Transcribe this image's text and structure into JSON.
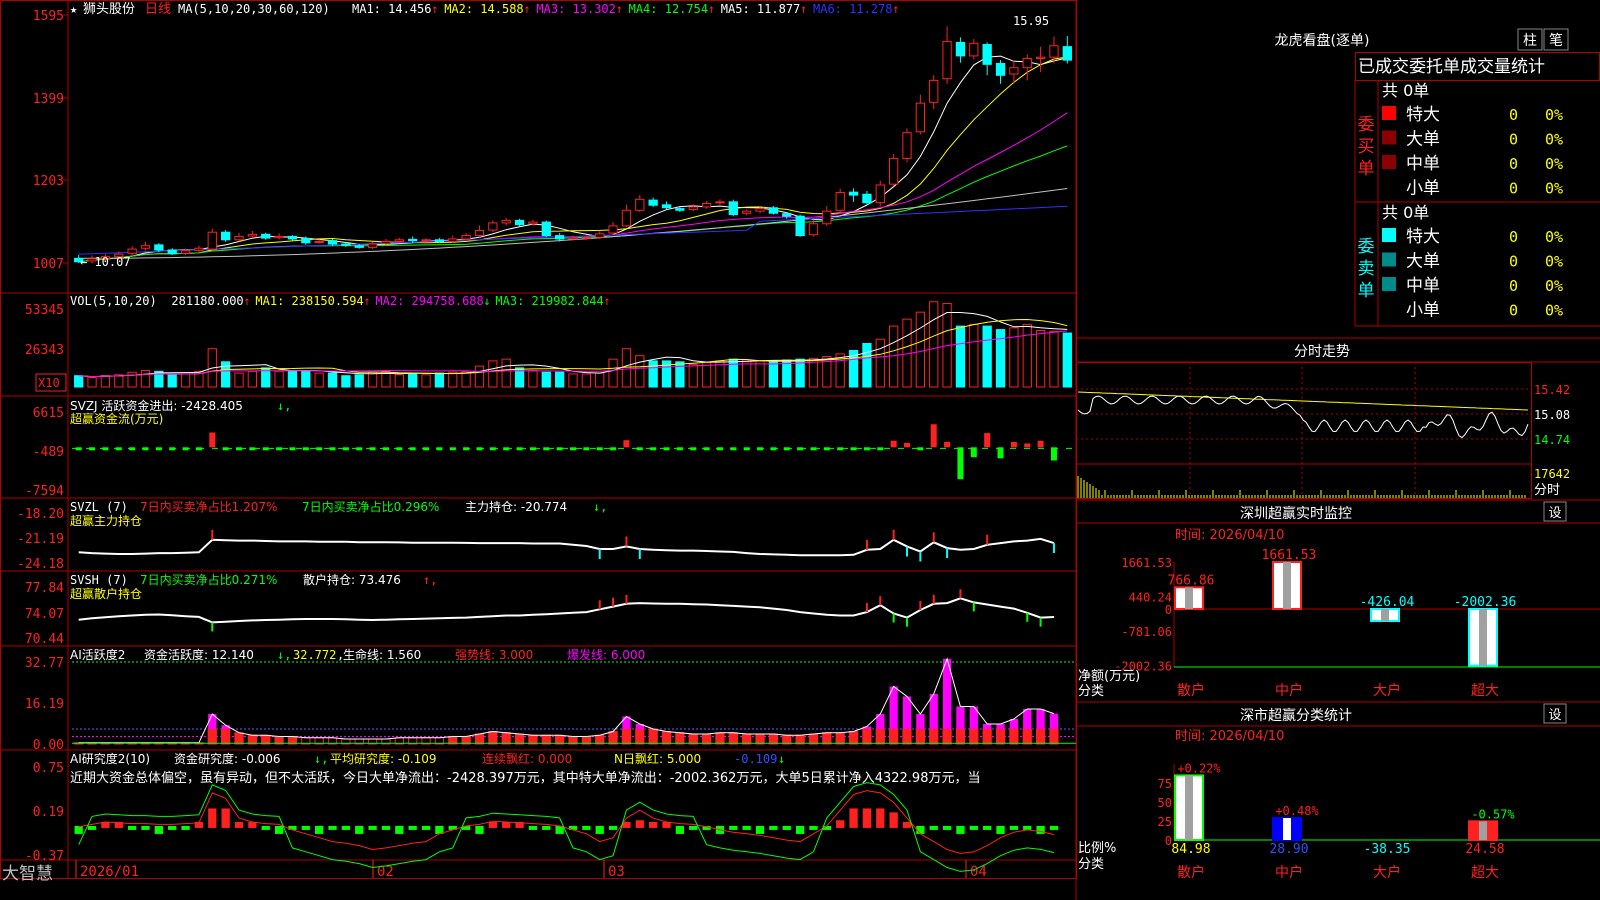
{
  "colors": {
    "up": "#ff2020",
    "down": "#00ffff",
    "grid": "#b00000",
    "ma1": "#ffffff",
    "ma2": "#ffff00",
    "ma3": "#ff00ff",
    "ma4": "#00ff00",
    "ma5": "#c0c0c0",
    "ma6": "#3030ff",
    "bg": "#000000"
  },
  "stock": {
    "star": "★",
    "name": "狮头股份",
    "period": "日线",
    "ma_params": "MA(5,10,20,30,60,120)",
    "mas": [
      {
        "label": "MA1: 14.456",
        "color": "#ffffff"
      },
      {
        "label": "MA2: 14.588",
        "color": "#ffff00"
      },
      {
        "label": "MA3: 13.302",
        "color": "#ff00ff"
      },
      {
        "label": "MA4: 12.754",
        "color": "#00ff00"
      },
      {
        "label": "MA5: 11.877",
        "color": "#ffffff"
      },
      {
        "label": "MA6: 11.278",
        "color": "#3030ff"
      }
    ],
    "high_label": "15.95",
    "low_label": "← 10.07"
  },
  "axis": {
    "price_ticks": [
      "1595",
      "1399",
      "1203",
      "1007"
    ],
    "vol_ticks": [
      "53345",
      "26343"
    ],
    "vol_unit": "X10",
    "svzj_ticks": [
      "6615",
      "-489",
      "-7594"
    ],
    "svzl_ticks": [
      "-18.20",
      "-21.19",
      "-24.18"
    ],
    "svsh_ticks": [
      "77.84",
      "74.07",
      "70.44"
    ],
    "ai_ticks": [
      "32.77",
      "16.19",
      "0.00"
    ],
    "res_ticks": [
      "0.75",
      "0.19",
      "-0.37"
    ],
    "dates": [
      "2026/01",
      "02",
      "03",
      "04"
    ]
  },
  "vol_header": {
    "params": "VOL(5,10,20)",
    "value": "281180.000",
    "ma1": "MA1: 238150.594",
    "ma2": "MA2: 294758.688",
    "ma3": "MA3: 219982.844"
  },
  "svzj_header": {
    "line1": "SVZJ  活跃资金进出: -2428.405",
    "line2": "超赢资金流(万元)"
  },
  "svzl_header": {
    "params": "SVZL (7)",
    "t1": "7日内买卖净占比1.207%",
    "t2": "7日内买卖净占比0.296%",
    "t3": "主力持仓: -20.774",
    "line2": "超赢主力持仓"
  },
  "svsh_header": {
    "params": "SVSH (7)",
    "t1": "7日内买卖净占比0.271%",
    "t2": "散户持仓: 73.476",
    "line2": "超赢散户持仓"
  },
  "ai_header": {
    "params": "AI活跃度2",
    "t1": "资金活跃度: 12.140",
    "t2": "32.772",
    "t3": "生命线: 1.560",
    "t4": "强势线: 3.000",
    "t5": "爆发线: 6.000"
  },
  "res_header": {
    "params": "AI研究度2(10)",
    "t1": "资金研究度: -0.006",
    "t2": "平均研究度: -0.109",
    "t3": "连续飘红: 0.000",
    "t4": "N日飘红: 5.000",
    "t5": "-0.109"
  },
  "res_comment": "近期大资金总体偏空，虽有异动，但不太活跃，今日大单净流出：-2428.397万元，其中特大单净流出：-2002.362万元，大单5日累计净入4322.98万元，当",
  "footer": {
    "brand": "大智慧"
  },
  "longhu": {
    "title": "龙虎看盘(逐单)",
    "btn1": "柱",
    "btn2": "笔",
    "tabs": "已成交委托单成交量统计",
    "buy": {
      "side": "委买单",
      "total": "共 0单",
      "rows": [
        {
          "label": "特大",
          "count": "0",
          "pct": "0%"
        },
        {
          "label": "大单",
          "count": "0",
          "pct": "0%"
        },
        {
          "label": "中单",
          "count": "0",
          "pct": "0%"
        },
        {
          "label": "小单",
          "count": "0",
          "pct": "0%"
        }
      ]
    },
    "sell": {
      "side": "委卖单",
      "total": "共 0单",
      "rows": [
        {
          "label": "特大",
          "count": "0",
          "pct": "0%"
        },
        {
          "label": "大单",
          "count": "0",
          "pct": "0%"
        },
        {
          "label": "中单",
          "count": "0",
          "pct": "0%"
        },
        {
          "label": "小单",
          "count": "0",
          "pct": "0%"
        }
      ]
    }
  },
  "intraday": {
    "title": "分时走势",
    "ticks": [
      "15.42",
      "15.08",
      "14.74",
      "17642"
    ],
    "unit": "分时"
  },
  "monitor": {
    "title": "深圳超赢实时监控",
    "btn": "设",
    "time": "时间: 2026/04/10",
    "ticks": [
      "1661.53",
      "440.24",
      "0",
      "-781.06",
      "-2002.36"
    ],
    "ylabel": "净额(万元)",
    "xlabel": "分类",
    "bars": [
      {
        "cat": "散户",
        "value": 766.86,
        "label": "766.86"
      },
      {
        "cat": "中户",
        "value": 1661.53,
        "label": "1661.53"
      },
      {
        "cat": "大户",
        "value": -426.04,
        "label": "-426.04"
      },
      {
        "cat": "超大",
        "value": -2002.36,
        "label": "-2002.36"
      }
    ]
  },
  "classify": {
    "title": "深市超赢分类统计",
    "btn": "设",
    "time": "时间: 2026/04/10",
    "ticks": [
      "75",
      "50",
      "25",
      "0"
    ],
    "ylabel": "比例%",
    "xlabel": "分类",
    "bars": [
      {
        "cat": "散户",
        "value": 84.98,
        "label": "84.98",
        "top": "+0.22%"
      },
      {
        "cat": "中户",
        "value": 28.9,
        "label": "28.90",
        "top": "+0.48%"
      },
      {
        "cat": "大户",
        "value": -38.35,
        "label": "-38.35",
        "top": ""
      },
      {
        "cat": "超大",
        "value": 24.58,
        "label": "24.58",
        "top": "-0.57%"
      }
    ]
  },
  "chart_data": {
    "type": "candlestick",
    "candles": [
      [
        10.18,
        10.1,
        10.26,
        10.07
      ],
      [
        10.12,
        10.17,
        10.25,
        10.06
      ],
      [
        10.18,
        10.22,
        10.28,
        10.14
      ],
      [
        10.22,
        10.28,
        10.34,
        10.18
      ],
      [
        10.3,
        10.4,
        10.47,
        10.24
      ],
      [
        10.42,
        10.48,
        10.57,
        10.36
      ],
      [
        10.5,
        10.38,
        10.54,
        10.33
      ],
      [
        10.38,
        10.29,
        10.42,
        10.26
      ],
      [
        10.3,
        10.36,
        10.41,
        10.26
      ],
      [
        10.37,
        10.42,
        10.48,
        10.31
      ],
      [
        10.4,
        10.8,
        10.88,
        10.36
      ],
      [
        10.8,
        10.62,
        10.85,
        10.57
      ],
      [
        10.62,
        10.7,
        10.78,
        10.58
      ],
      [
        10.71,
        10.75,
        10.83,
        10.66
      ],
      [
        10.75,
        10.66,
        10.79,
        10.62
      ],
      [
        10.67,
        10.7,
        10.77,
        10.63
      ],
      [
        10.7,
        10.64,
        10.73,
        10.6
      ],
      [
        10.65,
        10.55,
        10.7,
        10.5
      ],
      [
        10.57,
        10.58,
        10.63,
        10.53
      ],
      [
        10.6,
        10.52,
        10.64,
        10.48
      ],
      [
        10.52,
        10.49,
        10.56,
        10.45
      ],
      [
        10.48,
        10.44,
        10.52,
        10.41
      ],
      [
        10.44,
        10.52,
        10.57,
        10.4
      ],
      [
        10.53,
        10.58,
        10.64,
        10.49
      ],
      [
        10.58,
        10.62,
        10.67,
        10.54
      ],
      [
        10.63,
        10.6,
        10.7,
        10.55
      ],
      [
        10.6,
        10.62,
        10.66,
        10.56
      ],
      [
        10.62,
        10.58,
        10.66,
        10.54
      ],
      [
        10.58,
        10.64,
        10.72,
        10.55
      ],
      [
        10.64,
        10.72,
        10.78,
        10.6
      ],
      [
        10.72,
        10.84,
        10.96,
        10.68
      ],
      [
        10.85,
        11.02,
        11.08,
        10.8
      ],
      [
        11.02,
        11.08,
        11.14,
        10.96
      ],
      [
        11.08,
        10.98,
        11.12,
        10.94
      ],
      [
        11.0,
        11.04,
        11.09,
        10.96
      ],
      [
        11.04,
        10.72,
        11.08,
        10.68
      ],
      [
        10.72,
        10.64,
        10.78,
        10.58
      ],
      [
        10.64,
        10.67,
        10.72,
        10.6
      ],
      [
        10.67,
        10.68,
        10.72,
        10.62
      ],
      [
        10.68,
        10.76,
        10.82,
        10.64
      ],
      [
        10.78,
        10.95,
        11.04,
        10.74
      ],
      [
        10.95,
        11.32,
        11.45,
        10.92
      ],
      [
        11.32,
        11.58,
        11.68,
        11.28
      ],
      [
        11.56,
        11.44,
        11.62,
        11.4
      ],
      [
        11.45,
        11.38,
        11.53,
        11.34
      ],
      [
        11.36,
        11.32,
        11.4,
        11.28
      ],
      [
        11.34,
        11.4,
        11.46,
        11.3
      ],
      [
        11.4,
        11.48,
        11.54,
        11.36
      ],
      [
        11.5,
        11.52,
        11.58,
        11.45
      ],
      [
        11.52,
        11.22,
        11.57,
        11.18
      ],
      [
        11.25,
        11.3,
        11.34,
        11.2
      ],
      [
        11.3,
        11.36,
        11.4,
        11.25
      ],
      [
        11.38,
        11.25,
        11.42,
        11.22
      ],
      [
        11.24,
        11.18,
        11.28,
        11.12
      ],
      [
        11.18,
        10.72,
        11.22,
        10.69
      ],
      [
        10.74,
        11.0,
        11.1,
        10.7
      ],
      [
        11.0,
        11.3,
        11.42,
        10.95
      ],
      [
        11.32,
        11.74,
        11.83,
        11.26
      ],
      [
        11.75,
        11.68,
        11.84,
        11.52
      ],
      [
        11.7,
        11.5,
        11.78,
        11.45
      ],
      [
        11.5,
        11.92,
        12.02,
        11.42
      ],
      [
        11.94,
        12.55,
        12.66,
        11.9
      ],
      [
        12.55,
        13.16,
        13.26,
        12.46
      ],
      [
        13.18,
        13.86,
        14.06,
        13.12
      ],
      [
        13.88,
        14.4,
        14.52,
        13.72
      ],
      [
        14.44,
        15.32,
        15.68,
        14.32
      ],
      [
        15.3,
        14.98,
        15.42,
        14.82
      ],
      [
        14.98,
        15.28,
        15.38,
        14.9
      ],
      [
        15.25,
        14.78,
        15.3,
        14.52
      ],
      [
        14.8,
        14.52,
        14.88,
        14.32
      ],
      [
        14.55,
        14.7,
        14.86,
        14.32
      ],
      [
        14.7,
        14.92,
        15.02,
        14.4
      ],
      [
        14.92,
        14.95,
        15.2,
        14.6
      ],
      [
        14.95,
        15.22,
        15.44,
        14.8
      ],
      [
        15.2,
        14.88,
        15.45,
        14.8
      ]
    ],
    "volume": [
      13,
      11,
      13,
      14,
      17,
      19,
      18,
      14,
      15,
      18,
      44,
      29,
      16,
      18,
      22,
      18,
      19,
      18,
      16,
      16,
      13,
      14,
      17,
      18,
      14,
      16,
      14,
      16,
      17,
      18,
      24,
      30,
      32,
      22,
      19,
      17,
      17,
      15,
      15,
      16,
      32,
      44,
      36,
      30,
      30,
      29,
      26,
      28,
      30,
      32,
      31,
      30,
      30,
      31,
      32,
      33,
      35,
      38,
      42,
      50,
      55,
      70,
      78,
      86,
      98,
      96,
      70,
      72,
      70,
      66,
      68,
      72,
      65,
      64,
      62,
      56,
      62,
      68
    ],
    "svzj": [
      -200,
      -150,
      -120,
      -100,
      -80,
      -60,
      -60,
      -40,
      -60,
      -80,
      2700,
      -200,
      -100,
      -80,
      -120,
      -100,
      -80,
      -60,
      -90,
      -80,
      -70,
      -60,
      -50,
      -80,
      -60,
      -60,
      -120,
      -80,
      -100,
      -200,
      -160,
      -100,
      -120,
      -80,
      -60,
      -80,
      -100,
      -80,
      -60,
      -80,
      -150,
      1300,
      -200,
      -300,
      -300,
      -150,
      -120,
      -100,
      -200,
      -250,
      -150,
      -120,
      -200,
      -150,
      -200,
      -200,
      -100,
      -160,
      -150,
      -150,
      -120,
      1200,
      800,
      -300,
      4200,
      1000,
      -5800,
      -1800,
      2600,
      -2000,
      1000,
      700,
      1200,
      -2400
    ],
    "svzl": [
      -22.9,
      -23.0,
      -23.05,
      -23.1,
      -23.1,
      -23.05,
      -23.0,
      -23.0,
      -22.95,
      -22.9,
      -21.4,
      -21.45,
      -21.5,
      -21.5,
      -21.55,
      -21.6,
      -21.6,
      -21.6,
      -21.65,
      -21.65,
      -21.65,
      -21.7,
      -21.7,
      -21.7,
      -21.72,
      -21.75,
      -21.75,
      -21.75,
      -21.75,
      -21.78,
      -21.8,
      -21.8,
      -21.8,
      -21.8,
      -21.85,
      -21.85,
      -21.85,
      -22.0,
      -22.15,
      -22.5,
      -22.5,
      -22.2,
      -22.5,
      -22.6,
      -22.65,
      -22.7,
      -22.7,
      -22.75,
      -22.8,
      -22.85,
      -23.0,
      -23.1,
      -23.15,
      -23.2,
      -23.25,
      -23.25,
      -23.25,
      -23.25,
      -23.2,
      -22.6,
      -22.5,
      -21.4,
      -22.2,
      -22.8,
      -21.7,
      -22.4,
      -22.6,
      -22.5,
      -22.0,
      -21.8,
      -21.6,
      -21.5,
      -21.3,
      -21.8
    ],
    "svsh": [
      73.1,
      73.3,
      73.45,
      73.6,
      73.7,
      73.8,
      73.85,
      73.75,
      73.6,
      73.5,
      72.7,
      72.8,
      72.9,
      73.0,
      73.05,
      73.1,
      73.15,
      73.2,
      73.2,
      73.2,
      73.15,
      73.1,
      73.05,
      73.1,
      73.15,
      73.2,
      73.25,
      73.3,
      73.35,
      73.4,
      73.5,
      73.6,
      73.7,
      73.7,
      73.8,
      73.9,
      74.0,
      74.1,
      74.2,
      74.6,
      75.0,
      75.4,
      75.5,
      75.45,
      75.4,
      75.4,
      75.35,
      75.3,
      75.2,
      75.1,
      75.0,
      74.9,
      74.7,
      74.5,
      74.2,
      74.0,
      73.8,
      73.7,
      73.7,
      74.2,
      75.2,
      74.0,
      73.4,
      74.5,
      75.4,
      75.5,
      76.2,
      75.6,
      75.3,
      75.0,
      74.7,
      74.1,
      73.4,
      73.48
    ],
    "ai": [
      0.5,
      0.5,
      0.5,
      0.5,
      0.5,
      0.5,
      0.5,
      0.5,
      0.5,
      0.5,
      12.0,
      7.5,
      4.5,
      3.5,
      3.5,
      3.0,
      3.0,
      2.5,
      2.5,
      2.5,
      2.0,
      2.0,
      2.0,
      2.0,
      2.5,
      2.5,
      2.5,
      2.5,
      3.0,
      3.0,
      4.0,
      5.0,
      4.5,
      4.0,
      3.5,
      3.5,
      3.5,
      3.0,
      3.0,
      3.5,
      5.0,
      11.0,
      8.0,
      6.0,
      5.0,
      4.5,
      4.0,
      4.0,
      4.5,
      4.5,
      4.0,
      4.0,
      4.0,
      3.5,
      3.5,
      4.0,
      4.5,
      4.5,
      5.0,
      7.0,
      12.0,
      23.0,
      19.0,
      12.0,
      20.0,
      34.0,
      15.0,
      15.0,
      8.0,
      8.0,
      10.0,
      14.0,
      14.0,
      12.14
    ],
    "res": [
      -0.01,
      0.02,
      0.05,
      0.04,
      0.03,
      0.03,
      0.02,
      0.02,
      0.03,
      0.04,
      0.42,
      0.35,
      0.1,
      0.05,
      0.03,
      0.02,
      -0.05,
      -0.1,
      -0.15,
      -0.2,
      -0.22,
      -0.25,
      -0.3,
      -0.28,
      -0.25,
      -0.22,
      -0.2,
      -0.1,
      -0.05,
      0.0,
      0.02,
      0.06,
      0.05,
      0.04,
      0.03,
      0.02,
      0.0,
      -0.05,
      -0.1,
      -0.2,
      -0.15,
      0.1,
      0.2,
      0.1,
      0.05,
      0.03,
      0.02,
      -0.01,
      -0.05,
      -0.08,
      -0.1,
      -0.12,
      -0.15,
      -0.18,
      -0.2,
      -0.1,
      0.0,
      0.2,
      0.4,
      0.45,
      0.42,
      0.3,
      0.1,
      -0.1,
      -0.2,
      -0.3,
      -0.35,
      -0.33,
      -0.25,
      -0.15,
      -0.08,
      -0.05,
      -0.07,
      -0.11
    ]
  }
}
